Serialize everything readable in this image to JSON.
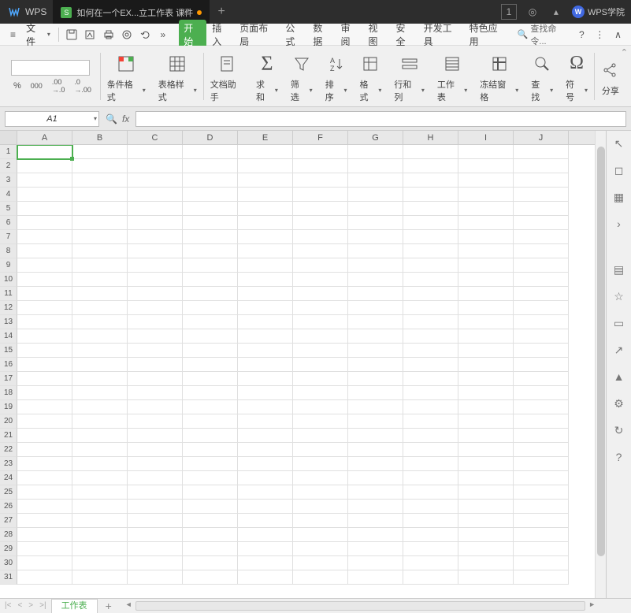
{
  "app": {
    "name": "WPS",
    "logo": "W"
  },
  "tab": {
    "title": "如何在一个EX...立工作表 课件",
    "icon": "S"
  },
  "titleRight": {
    "badge": "1",
    "academy": "WPS学院"
  },
  "fileMenu": "文件",
  "quickAccess": {
    "hamburger": "≡"
  },
  "menus": [
    "开始",
    "插入",
    "页面布局",
    "公式",
    "数据",
    "审阅",
    "视图",
    "安全",
    "开发工具",
    "特色应用"
  ],
  "searchCmd": "查找命令...",
  "ribbon": {
    "percent": "%",
    "thousand": "000",
    "decInc": ".00→.0",
    "decDec": ".0→.00",
    "condFmt": "条件格式",
    "tableStyle": "表格样式",
    "docAssist": "文档助手",
    "sum": "求和",
    "filter": "筛选",
    "sort": "排序",
    "format": "格式",
    "rowCol": "行和列",
    "sheet": "工作表",
    "freeze": "冻结窗格",
    "find": "查找",
    "symbol": "符号",
    "share": "分享"
  },
  "nameBox": "A1",
  "fx": "fx",
  "columns": [
    "A",
    "B",
    "C",
    "D",
    "E",
    "F",
    "G",
    "H",
    "I",
    "J"
  ],
  "rows": [
    "1",
    "2",
    "3",
    "4",
    "5",
    "6",
    "7",
    "8",
    "9",
    "10",
    "11",
    "12",
    "13",
    "14",
    "15",
    "16",
    "17",
    "18",
    "19",
    "20",
    "21",
    "22",
    "23",
    "24",
    "25",
    "26",
    "27",
    "28",
    "29",
    "30",
    "31"
  ],
  "activeCell": {
    "row": 0,
    "col": 0
  },
  "sheetTab": "工作表"
}
